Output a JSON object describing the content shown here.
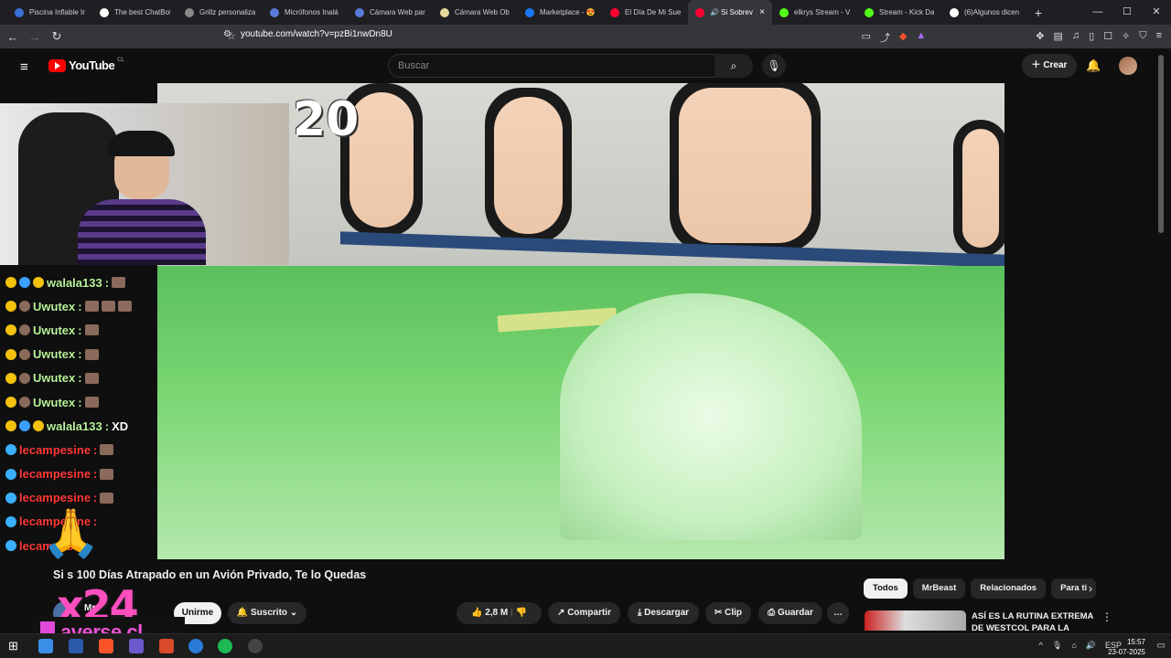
{
  "browser": {
    "tabs": [
      {
        "title": "Piscina Inflable In",
        "color": "#3b6fd8"
      },
      {
        "title": "The best ChatBot",
        "color": "#ffffff"
      },
      {
        "title": "Grillz personaliza",
        "color": "#888888"
      },
      {
        "title": "Micrófonos Inalá",
        "color": "#5a7ad8"
      },
      {
        "title": "Cámara Web par",
        "color": "#5a7ad8"
      },
      {
        "title": "Cámara Web Ob",
        "color": "#e6d89a"
      },
      {
        "title": "Marketplace - 😍",
        "color": "#1877f2"
      },
      {
        "title": "El Día De Mi Sue",
        "color": "#ff0033"
      },
      {
        "title": "🔊 Si Sobrev",
        "color": "#ff0033",
        "active": true
      },
      {
        "title": "elkrys Stream - V",
        "color": "#53fc18"
      },
      {
        "title": "Stream - Kick Da",
        "color": "#53fc18"
      },
      {
        "title": "(6)Algunos dicen",
        "color": "#ffffff"
      }
    ],
    "close_tab": "×",
    "new_tab": "+",
    "window_controls": {
      "minimize": "—",
      "maximize": "☐",
      "close": "✕"
    },
    "url": "youtube.com/watch?v=pzBi1nwDn8U"
  },
  "youtube": {
    "logo_text": "YouTube",
    "country": "CL",
    "search_placeholder": "Buscar",
    "create_label": "Crear",
    "video_overlay_number": "20",
    "video_title": "Si Sobrevives 100 Días Atrapado en un Avión Privado, Te lo Quedas",
    "video_title_visible": "Si          s 100 Días Atrapado en un Avión Privado, Te lo Quedas",
    "channel_name": "Mr",
    "join_label": "Unirme",
    "subscribed_label": "Suscrito",
    "likes": "2,8 M",
    "share_label": "Compartir",
    "download_label": "Descargar",
    "clip_label": "Clip",
    "save_label": "Guardar",
    "more_label": "…",
    "chips": [
      "Todos",
      "MrBeast",
      "Relacionados",
      "Para ti"
    ],
    "chip_next": "›",
    "reco_title": "ASÍ ES LA RUTINA EXTREMA DE WESTCOL PARA LA VELADA",
    "reco_menu": "⋮"
  },
  "stream_overlay": {
    "chat": [
      {
        "user": "walala133",
        "text": "",
        "color": "#b9f29a",
        "badges": [
          "#f4c20d",
          "#3aa0ff",
          "#f4c20d"
        ],
        "emotes": 1
      },
      {
        "user": "Uwutex",
        "text": "",
        "color": "#b9f29a",
        "badges": [
          "#f4c20d",
          "#8a6a5a"
        ],
        "emotes": 3
      },
      {
        "user": "Uwutex",
        "text": "",
        "color": "#b9f29a",
        "badges": [
          "#f4c20d",
          "#8a6a5a"
        ],
        "emotes": 1
      },
      {
        "user": "Uwutex",
        "text": "",
        "color": "#b9f29a",
        "badges": [
          "#f4c20d",
          "#8a6a5a"
        ],
        "emotes": 1
      },
      {
        "user": "Uwutex",
        "text": "",
        "color": "#b9f29a",
        "badges": [
          "#f4c20d",
          "#8a6a5a"
        ],
        "emotes": 1
      },
      {
        "user": "Uwutex",
        "text": "",
        "color": "#b9f29a",
        "badges": [
          "#f4c20d",
          "#8a6a5a"
        ],
        "emotes": 1
      },
      {
        "user": "walala133",
        "text": "XD",
        "color": "#b9f29a",
        "badges": [
          "#f4c20d",
          "#3aa0ff",
          "#f4c20d"
        ],
        "emotes": 0
      },
      {
        "user": "lecampesine",
        "text": "",
        "color": "#ff3a3a",
        "badges": [
          "#3ab0ff"
        ],
        "emotes": 1
      },
      {
        "user": "lecampesine",
        "text": "",
        "color": "#ff3a3a",
        "badges": [
          "#3ab0ff"
        ],
        "emotes": 1
      },
      {
        "user": "lecampesine",
        "text": "",
        "color": "#ff3a3a",
        "badges": [
          "#3ab0ff"
        ],
        "emotes": 1
      },
      {
        "user": "lecampesine",
        "text": "",
        "color": "#ff3a3a",
        "badges": [
          "#3ab0ff"
        ],
        "emotes": 0
      },
      {
        "user": "lecampes",
        "text": "",
        "color": "#ff3a3a",
        "badges": [
          "#3ab0ff"
        ],
        "emotes": 0
      }
    ],
    "gift_multiplier": "x24",
    "sponsor": "averse.cl"
  },
  "taskbar": {
    "language": "ESP",
    "time": "15:57",
    "date": "23-07-2025"
  }
}
